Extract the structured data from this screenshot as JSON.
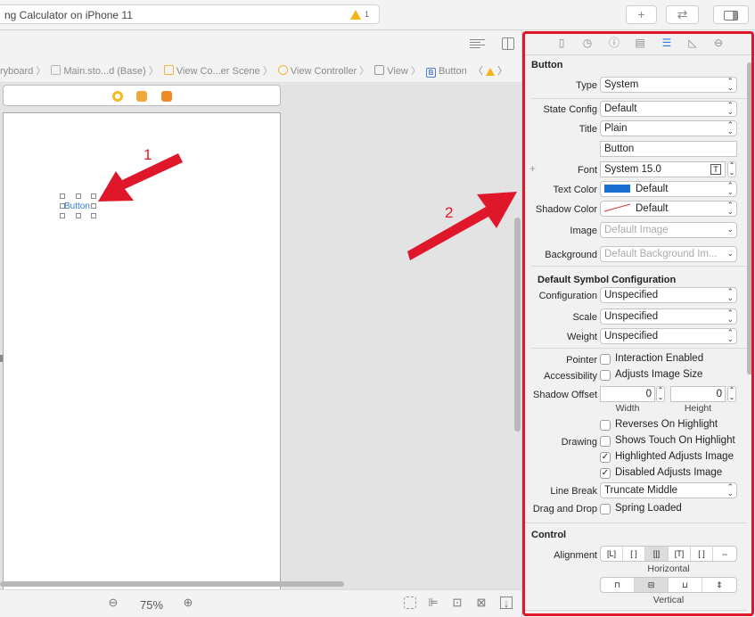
{
  "toolbar": {
    "scheme_title": "ng Calculator on iPhone 11",
    "warning_count": "1",
    "add_icon": "plus-icon",
    "swap_icon": "arrows-swap-icon",
    "inspector_toggle_icon": "sidebar-right-icon"
  },
  "breadcrumbs": [
    "ryboard",
    "Main.sto...d (Base)",
    "View Co...er Scene",
    "View Controller",
    "View",
    "Button"
  ],
  "canvas": {
    "button_label": "Button",
    "annotation_1": "1",
    "annotation_2": "2"
  },
  "bottom": {
    "zoom": "75%",
    "zoom_out_icon": "magnifier-minus-icon",
    "zoom_in_icon": "magnifier-plus-icon"
  },
  "inspector": {
    "tab_icons": [
      "file-icon",
      "history-icon",
      "help-icon",
      "identity-icon",
      "attributes-icon",
      "size-icon",
      "connections-icon"
    ],
    "button_section": "Button",
    "type_label": "Type",
    "type_value": "System",
    "state_label": "State Config",
    "state_value": "Default",
    "title_label": "Title",
    "title_value": "Plain",
    "title_text": "Button",
    "font_label": "Font",
    "font_value": "System 15.0",
    "text_color_label": "Text Color",
    "text_color_value": "Default",
    "text_color_swatch": "#1a6fd1",
    "shadow_color_label": "Shadow Color",
    "shadow_color_value": "Default",
    "image_label": "Image",
    "image_placeholder": "Default Image",
    "background_label": "Background",
    "background_placeholder": "Default Background Im...",
    "symbol_section": "Default Symbol Configuration",
    "config_label": "Configuration",
    "config_value": "Unspecified",
    "scale_label": "Scale",
    "scale_value": "Unspecified",
    "weight_label": "Weight",
    "weight_value": "Unspecified",
    "pointer_label": "Pointer",
    "pointer_option": "Interaction Enabled",
    "accessibility_label": "Accessibility",
    "accessibility_option": "Adjusts Image Size",
    "shadow_offset_label": "Shadow Offset",
    "shadow_width": "0",
    "shadow_height": "0",
    "width_label": "Width",
    "height_label": "Height",
    "reverses_option": "Reverses On Highlight",
    "drawing_label": "Drawing",
    "shows_touch_option": "Shows Touch On Highlight",
    "highlighted_option": "Highlighted Adjusts Image",
    "disabled_option": "Disabled Adjusts Image",
    "line_break_label": "Line Break",
    "line_break_value": "Truncate Middle",
    "drag_drop_label": "Drag and Drop",
    "drag_drop_option": "Spring Loaded",
    "control_section": "Control",
    "alignment_label": "Alignment",
    "horizontal_label": "Horizontal",
    "vertical_label": "Vertical",
    "highlight_color": "#e0162a"
  }
}
